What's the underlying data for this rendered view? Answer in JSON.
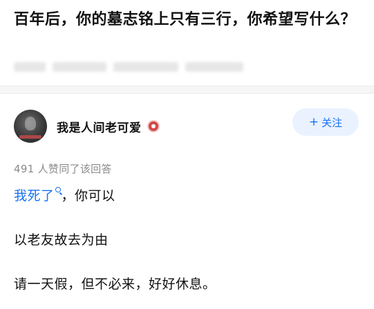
{
  "question": {
    "title": "百年后，你的墓志铭上只有三行，你希望写什么？"
  },
  "answer": {
    "author": {
      "name": "我是人间老可爱",
      "avatar_icon": "avatar-photo",
      "badge_icon": "creator-badge-icon"
    },
    "follow_button": {
      "plus": "+",
      "label": "关注"
    },
    "vote_text": "491 人赞同了该回答",
    "content": {
      "line1_link": "我死了",
      "line1_rest": "，你可以",
      "line2": "以老友故去为由",
      "line3": "请一天假，但不必来，好好休息。"
    }
  },
  "colors": {
    "link_blue": "#1772f6",
    "follow_bg": "#eaf2ff",
    "meta_gray": "#8a8a8a",
    "badge_red": "#d04a4a"
  }
}
